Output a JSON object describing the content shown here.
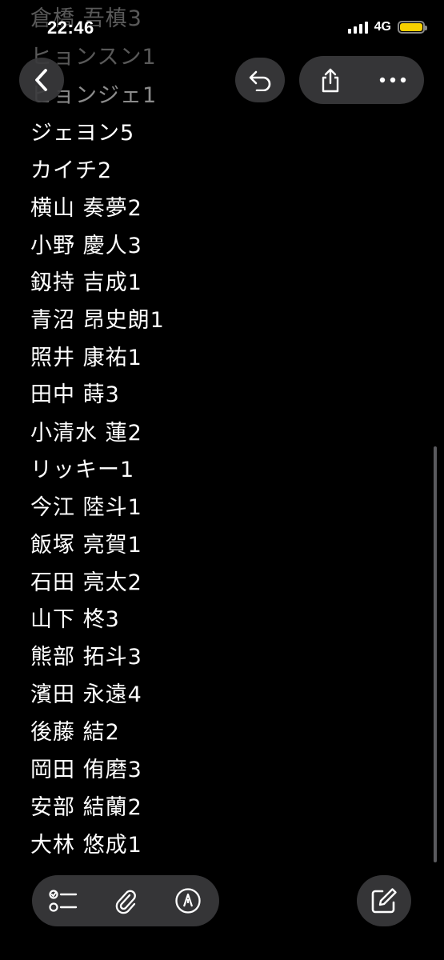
{
  "status_bar": {
    "time": "22:46",
    "network": "4G",
    "battery_color": "#f7d000"
  },
  "toolbar": {
    "back_icon": "chevron-left-icon",
    "undo_icon": "undo-icon",
    "share_icon": "share-icon",
    "more_icon": "more-icon"
  },
  "note": {
    "lines": [
      "倉橋 吾槙3",
      "ヒョンスン1",
      "ヒョンジェ1",
      "ジェヨン5",
      "カイチ2",
      "横山 奏夢2",
      "小野 慶人3",
      "釼持 吉成1",
      "青沼 昂史朗1",
      "照井 康祐1",
      "田中 蒔3",
      "小清水 蓮2",
      "リッキー1",
      "今江 陸斗1",
      "飯塚 亮賀1",
      "石田 亮太2",
      "山下 柊3",
      "熊部 拓斗3",
      "濱田 永遠4",
      "後藤 結2",
      "岡田 侑磨3",
      "安部 結蘭2",
      "大林 悠成1"
    ]
  },
  "bottom_toolbar": {
    "checklist_icon": "checklist-icon",
    "attachment_icon": "paperclip-icon",
    "markup_icon": "pen-markup-icon",
    "compose_icon": "compose-icon"
  }
}
